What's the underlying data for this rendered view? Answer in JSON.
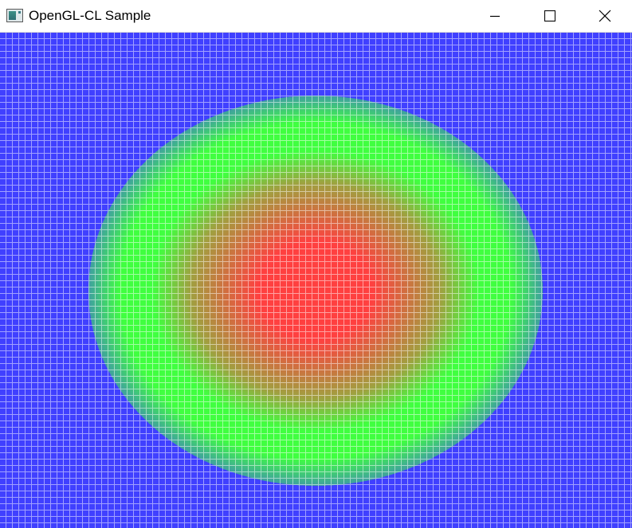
{
  "window": {
    "title": "OpenGL-CL Sample",
    "icons": {
      "app": "application-window-icon",
      "minimize": "minimize-icon",
      "maximize": "maximize-icon",
      "close": "close-icon"
    }
  },
  "visualization": {
    "colors": {
      "outer": "#4040ff",
      "middle": "#40ff40",
      "center": "#ff4040",
      "grid": "#ffffff"
    }
  }
}
